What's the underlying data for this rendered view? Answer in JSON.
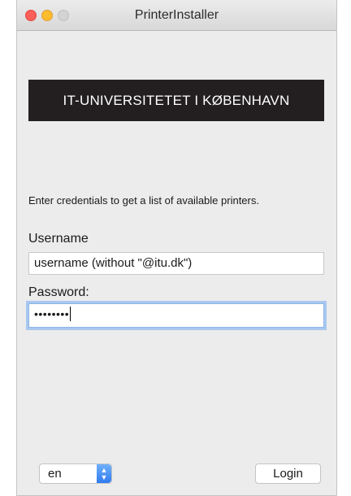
{
  "window": {
    "title": "PrinterInstaller"
  },
  "branding": {
    "logo_text": "IT-UNIVERSITETET I KØBENHAVN"
  },
  "form": {
    "instructions": "Enter credentials to get a list of available printers.",
    "username_label": "Username",
    "username_value": "username (without \"@itu.dk\")",
    "password_label": "Password:",
    "password_masked": "••••••••"
  },
  "footer": {
    "language_selected": "en",
    "login_label": "Login"
  },
  "colors": {
    "window_bg": "#ececec",
    "logo_bg": "#231f20",
    "focus_ring": "#a8c8f0",
    "select_accent": "#2f7bf0"
  }
}
